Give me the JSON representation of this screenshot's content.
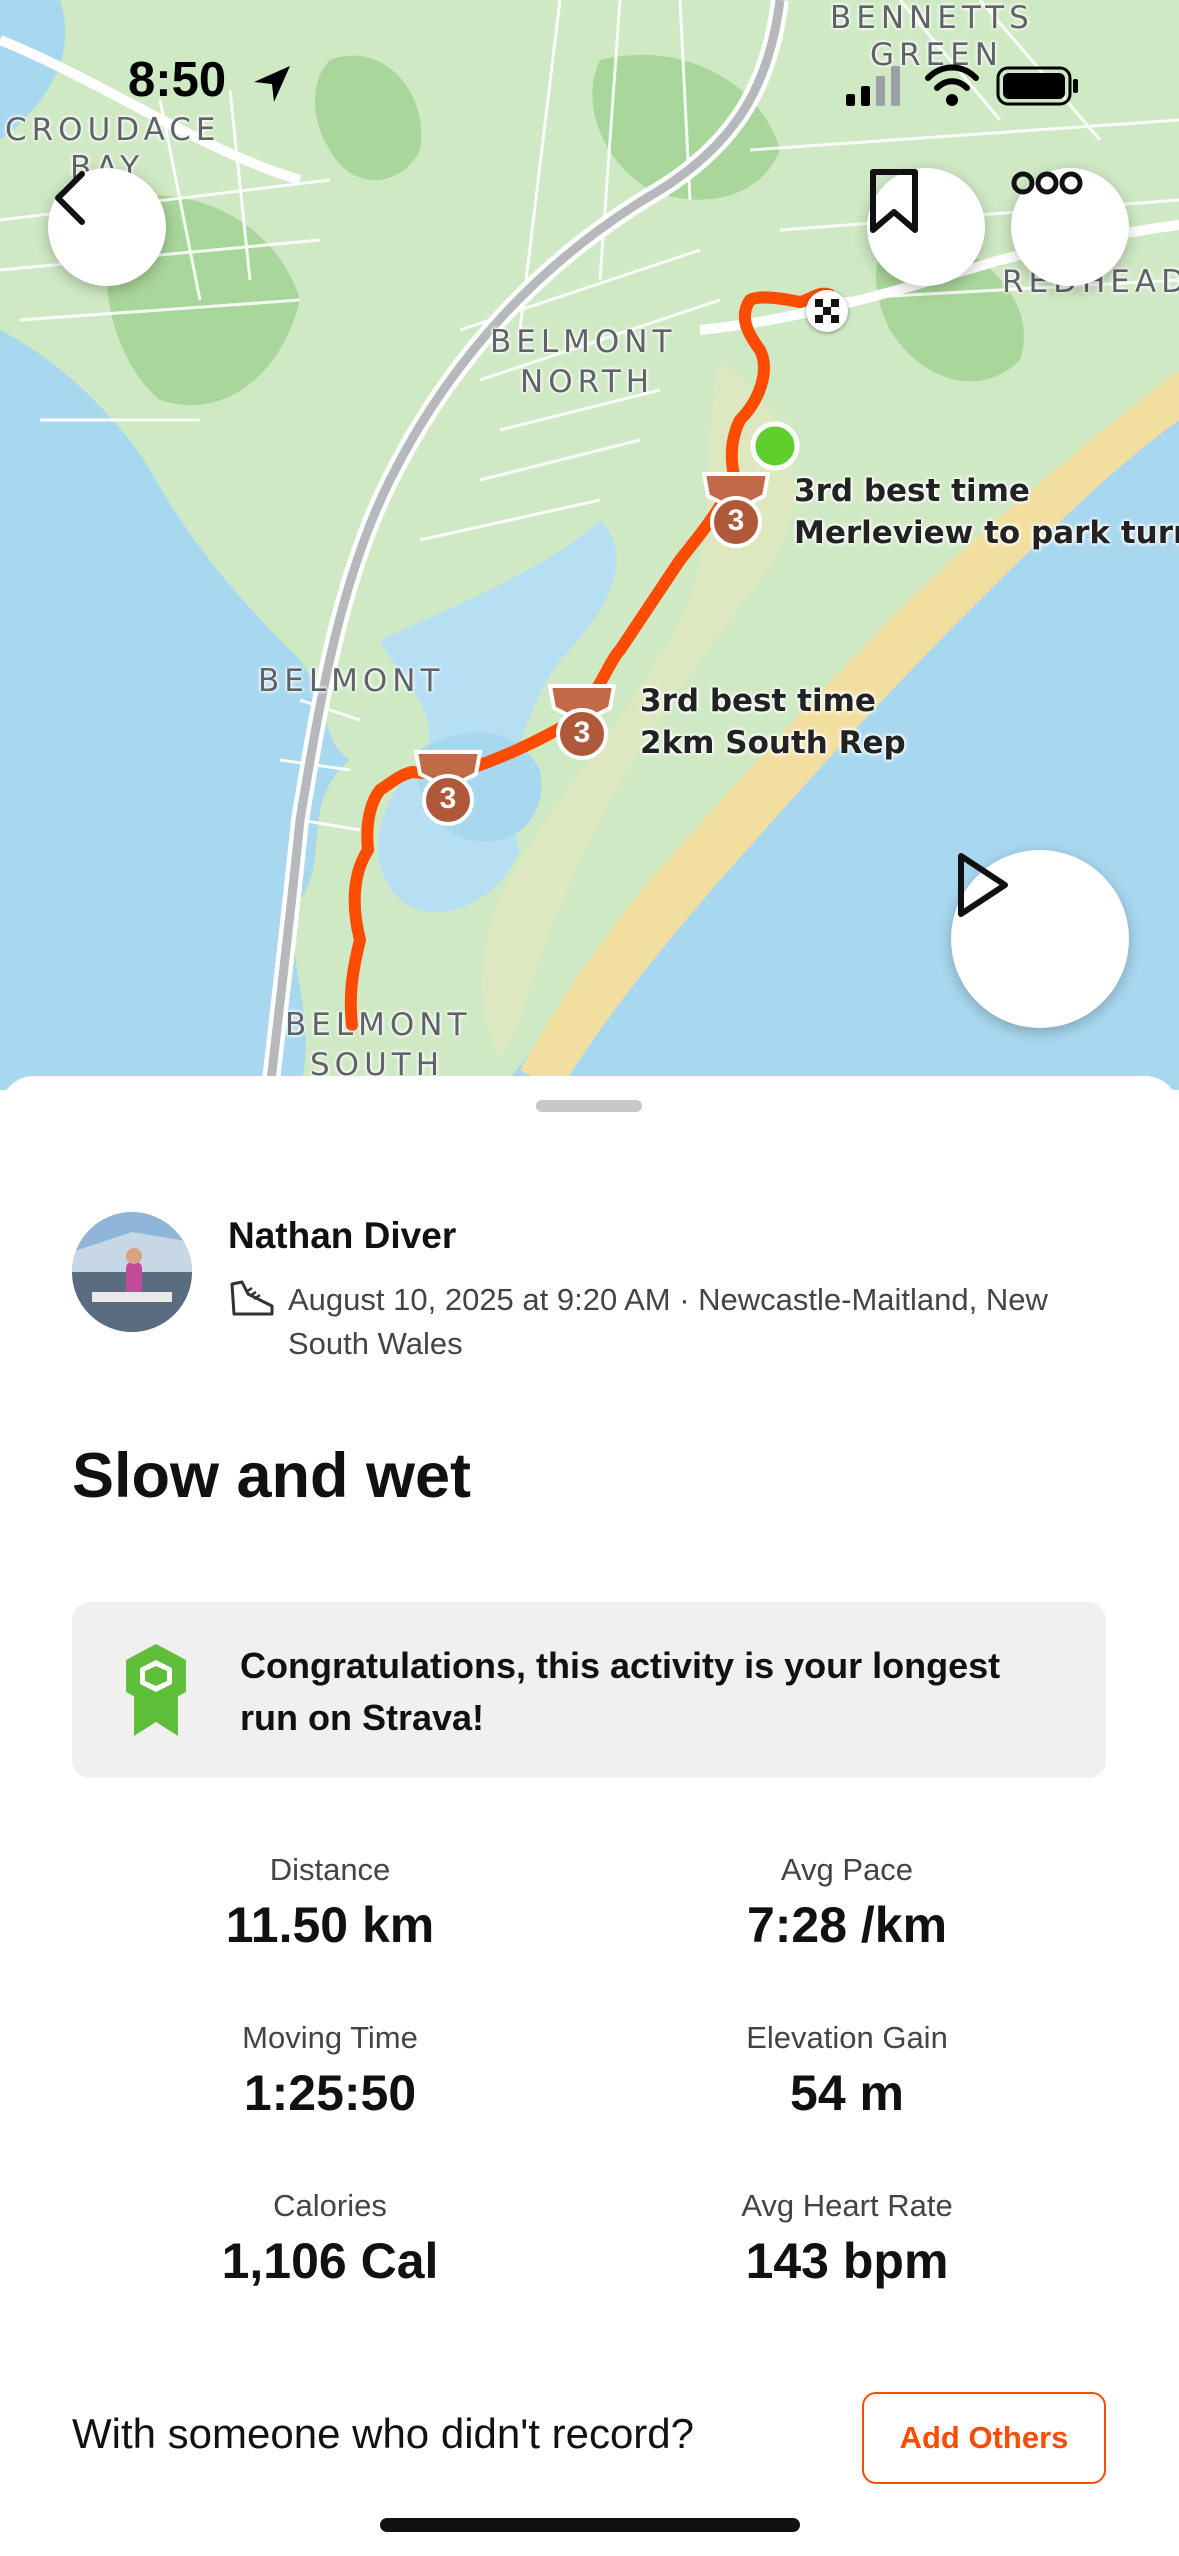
{
  "status_bar": {
    "time": "8:50"
  },
  "map": {
    "places": [
      "CROUDACE",
      "BAY",
      "BENNETTS",
      "GREEN",
      "REDHEAD",
      "BELMONT",
      "NORTH",
      "BELMONT",
      "BELMONT",
      "SOUTH"
    ],
    "segments": [
      {
        "rank": "3",
        "line1": "3rd best time",
        "line2": "Merleview to park turn-o"
      },
      {
        "rank": "3",
        "line1": "3rd best time",
        "line2": "2km South Rep"
      },
      {
        "rank": "3"
      }
    ],
    "route_color": "#fc4c02"
  },
  "activity": {
    "athlete": "Nathan Diver",
    "meta": "August 10, 2025 at 9:20 AM · Newcastle-Maitland, New South Wales",
    "title": "Slow and wet",
    "achievement": "Congratulations, this activity is your longest run on Strava!",
    "stats": [
      {
        "label": "Distance",
        "value": "11.50 km"
      },
      {
        "label": "Avg Pace",
        "value": "7:28 /km"
      },
      {
        "label": "Moving Time",
        "value": "1:25:50"
      },
      {
        "label": "Elevation Gain",
        "value": "54 m"
      },
      {
        "label": "Calories",
        "value": "1,106 Cal"
      },
      {
        "label": "Avg Heart Rate",
        "value": "143 bpm"
      }
    ]
  },
  "footer": {
    "prompt": "With someone who didn't record?",
    "add_others": "Add Others"
  },
  "colors": {
    "accent": "#fc4c02",
    "achievement_green": "#5fbf3a",
    "water": "#a8d8f0",
    "land": "#cfe9c4"
  },
  "icons": [
    "location-arrow-icon",
    "back-chevron-icon",
    "bookmark-icon",
    "more-icon",
    "play-icon",
    "shoe-icon",
    "achievement-badge-icon",
    "medal-icon",
    "finish-flag-icon"
  ]
}
